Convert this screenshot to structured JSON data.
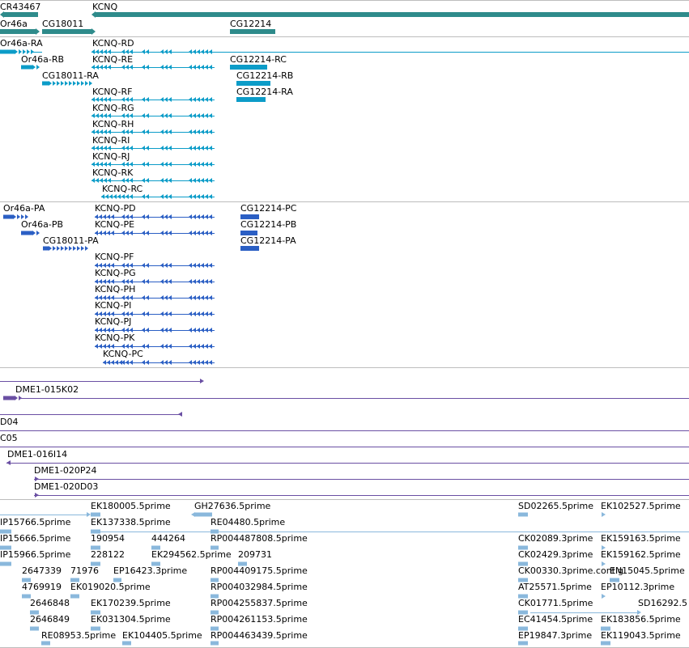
{
  "colors": {
    "gene": "#2e8b8b",
    "transcript": "#0c9cc8",
    "protein": "#2b5fc4",
    "clone": "#6a4fa3",
    "est": "#8ab8dc",
    "separator": "#bdbdbd"
  },
  "genes": {
    "labels": [
      "CR43467",
      "KCNQ",
      "Or46a",
      "CG18011",
      "CG12214"
    ]
  },
  "transcripts": {
    "labels": [
      "Or46a-RA",
      "KCNQ-RD",
      "Or46a-RB",
      "KCNQ-RE",
      "CG12214-RC",
      "CG18011-RA",
      "CG12214-RB",
      "CG12214-RA",
      "KCNQ-RF",
      "KCNQ-RG",
      "KCNQ-RH",
      "KCNQ-RI",
      "KCNQ-RJ",
      "KCNQ-RK",
      "KCNQ-RC"
    ]
  },
  "proteins": {
    "labels": [
      "Or46a-PA",
      "KCNQ-PD",
      "CG12214-PC",
      "Or46a-PB",
      "KCNQ-PE",
      "CG12214-PB",
      "CG18011-PA",
      "CG12214-PA",
      "KCNQ-PF",
      "KCNQ-PG",
      "KCNQ-PH",
      "KCNQ-PI",
      "KCNQ-PJ",
      "KCNQ-PK",
      "KCNQ-PC"
    ]
  },
  "clones": {
    "labels": [
      "DME1-015K02",
      "D04",
      "C05",
      "DME1-016I14",
      "DME1-020P24",
      "DME1-020D03"
    ]
  },
  "ests": {
    "labels": [
      "EK180005.5prime",
      "GH27636.5prime",
      "SD02265.5prime",
      "EK102527.5prime",
      "IP15766.5prime",
      "EK137338.5prime",
      "RE04480.5prime",
      "IP15666.5prime",
      "190954",
      "444264",
      "RP004487808.5prime",
      "CK02089.3prime",
      "EK159163.5prime",
      "IP15966.5prime",
      "228122",
      "EK294562.5prime",
      "209731",
      "CK02429.3prime",
      "EK159162.5prime",
      "2647339",
      "71976",
      "EP16423.3prime",
      "RP004409175.5prime",
      "CK00330.3prime.contig",
      "EN15045.5prime",
      "4769919",
      "EK019020.5prime",
      "RP004032984.5prime",
      "AT25571.5prime",
      "EP10112.3prime",
      "2646848",
      "EK170239.5prime",
      "RP004255837.5prime",
      "CK01771.5prime",
      "SD16292.5",
      "2646849",
      "EK031304.5prime",
      "RP004261153.5prime",
      "EC41454.5prime",
      "EK183856.5prime",
      "RE08953.5prime",
      "EK104405.5prime",
      "RP004463439.5prime",
      "EP19847.3prime",
      "EK119043.5prime"
    ]
  }
}
